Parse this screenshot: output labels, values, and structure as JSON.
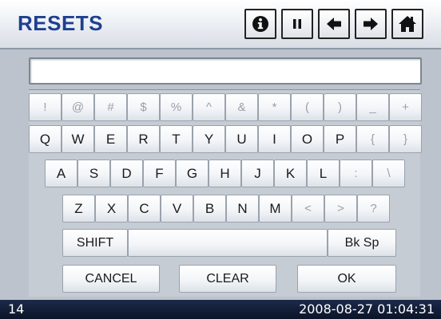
{
  "header": {
    "title": "RESETS",
    "buttons": [
      {
        "icon": "info-icon"
      },
      {
        "icon": "pause-icon"
      },
      {
        "icon": "arrow-left-icon"
      },
      {
        "icon": "arrow-right-icon"
      },
      {
        "icon": "home-icon"
      }
    ]
  },
  "input": {
    "value": ""
  },
  "keyboard": {
    "row1": [
      "!",
      "@",
      "#",
      "$",
      "%",
      "^",
      "&",
      "*",
      "(",
      ")",
      "_",
      "+"
    ],
    "row2": [
      "Q",
      "W",
      "E",
      "R",
      "T",
      "Y",
      "U",
      "I",
      "O",
      "P",
      "{",
      "}"
    ],
    "row3": [
      "A",
      "S",
      "D",
      "F",
      "G",
      "H",
      "J",
      "K",
      "L",
      ":",
      "\\"
    ],
    "row4": [
      "Z",
      "X",
      "C",
      "V",
      "B",
      "N",
      "M",
      "<",
      ">",
      "?"
    ],
    "shift_label": "SHIFT",
    "space_label": "",
    "backspace_label": "Bk Sp",
    "cancel_label": "CANCEL",
    "clear_label": "CLEAR",
    "ok_label": "OK"
  },
  "status": {
    "left": "14",
    "datetime": "2008-08-27 01:04:31"
  },
  "colors": {
    "title": "#1f3f8f",
    "status_bg": "#0b1428",
    "symbol_key_text": "#9aa0a8"
  }
}
